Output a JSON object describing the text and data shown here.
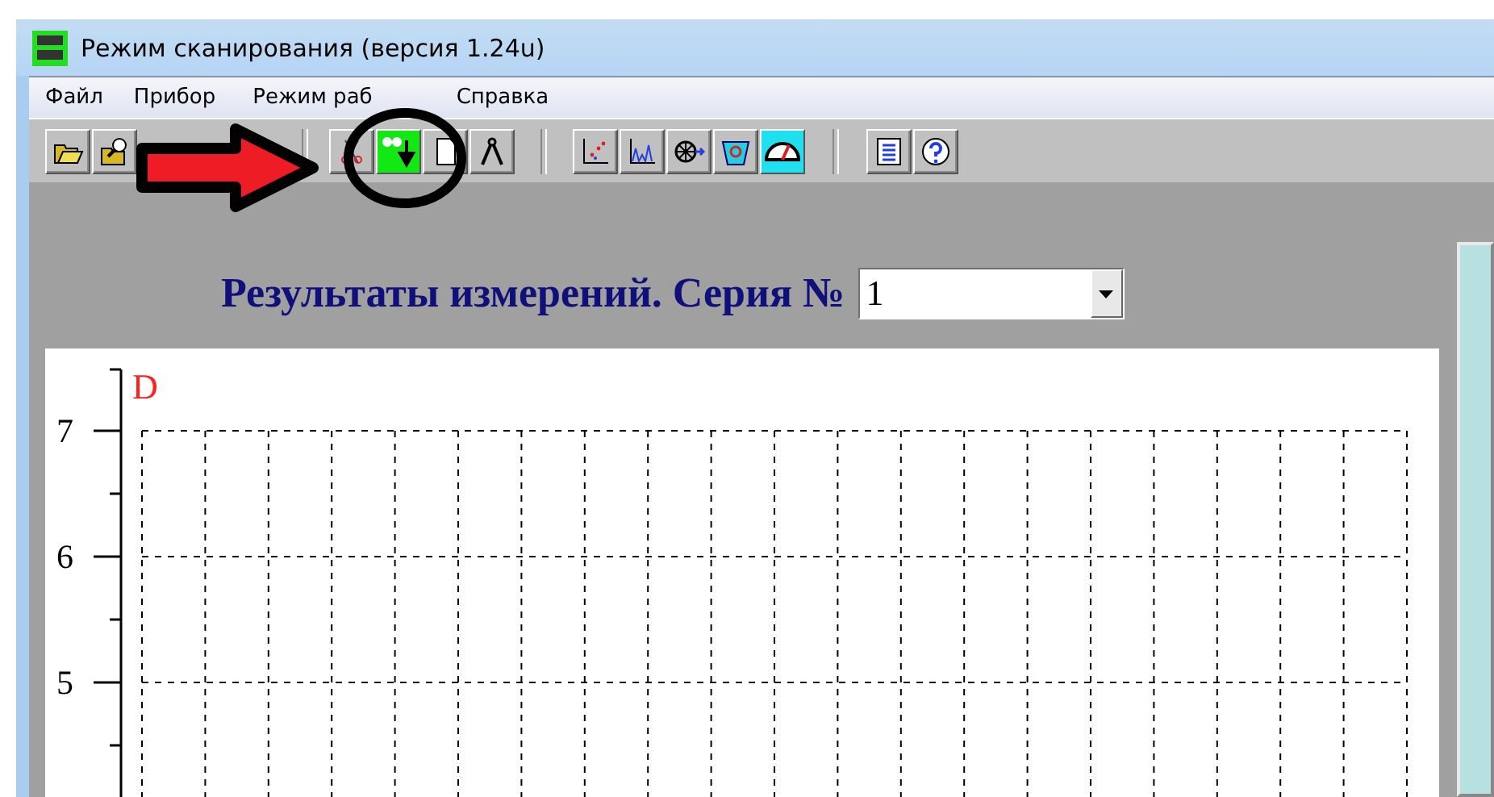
{
  "window": {
    "title": "Режим сканирования (версия 1.24u)"
  },
  "menu": [
    {
      "label": "Файл"
    },
    {
      "label": "Прибор"
    },
    {
      "label": "Режим раб"
    },
    {
      "label": "Справка"
    }
  ],
  "results": {
    "heading": "Результаты измерений. Серия №",
    "series_select": {
      "value": "1"
    }
  },
  "chart": {
    "axis_title": "D",
    "y_tick_labels": [
      "7",
      "6",
      "5"
    ]
  }
}
